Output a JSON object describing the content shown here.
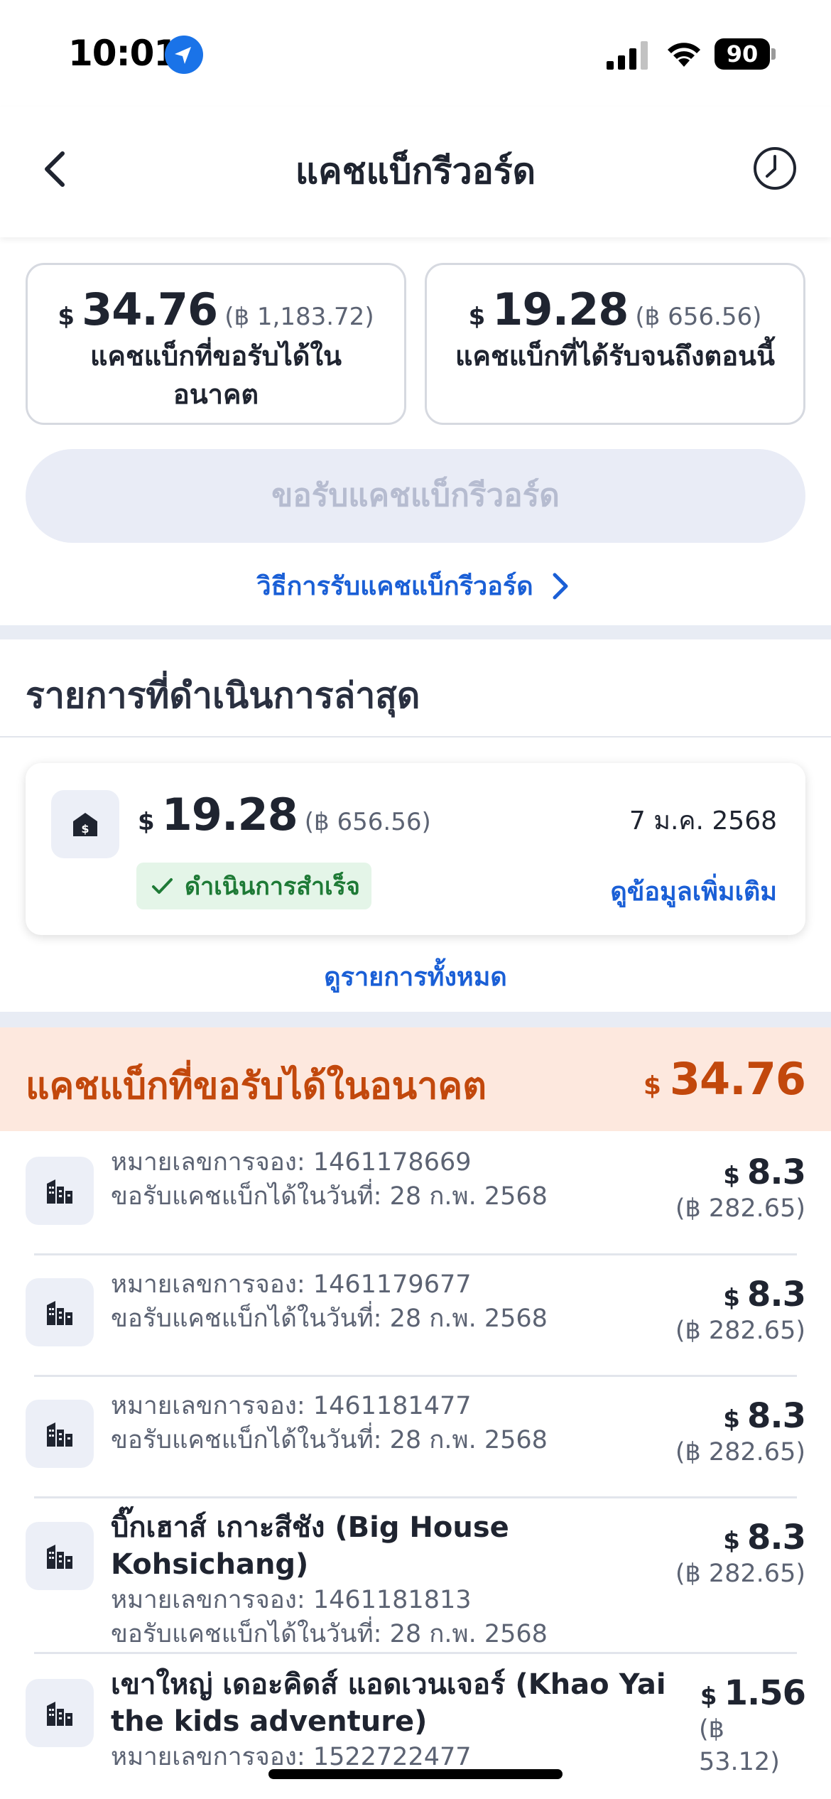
{
  "status": {
    "time": "10:01",
    "battery": "90"
  },
  "header": {
    "title": "แคชแบ็กรีวอร์ด"
  },
  "summary": {
    "future": {
      "currency": "$",
      "amount": "34.76",
      "thb": "(฿ 1,183.72)",
      "label": "แคชแบ็กที่ขอรับได้ในอนาคต"
    },
    "received": {
      "currency": "$",
      "amount": "19.28",
      "thb": "(฿ 656.56)",
      "label": "แคชแบ็กที่ได้รับจนถึงตอนนี้"
    },
    "claim_label": "ขอรับแคชแบ็กรีวอร์ด",
    "howto_label": "วิธีการรับแคชแบ็กรีวอร์ด"
  },
  "recent": {
    "title": "รายการที่ดำเนินการล่าสุด",
    "transaction": {
      "currency": "$",
      "amount": "19.28",
      "thb": "(฿ 656.56)",
      "date": "7 ม.ค. 2568",
      "status": "ดำเนินการสำเร็จ",
      "more_label": "ดูข้อมูลเพิ่มเติม"
    },
    "view_all_label": "ดูรายการทั้งหมด"
  },
  "future_section": {
    "title": "แคชแบ็กที่ขอรับได้ในอนาคต",
    "currency": "$",
    "total": "34.76",
    "bookings": [
      {
        "name": "",
        "booking": "หมายเลขการจอง: 1461178669",
        "claim_date": "ขอรับแคชแบ็กได้ในวันที่: 28 ก.พ. 2568",
        "currency": "$",
        "amount": "8.3",
        "thb": "(฿ 282.65)"
      },
      {
        "name": "",
        "booking": "หมายเลขการจอง: 1461179677",
        "claim_date": "ขอรับแคชแบ็กได้ในวันที่: 28 ก.พ. 2568",
        "currency": "$",
        "amount": "8.3",
        "thb": "(฿ 282.65)"
      },
      {
        "name": "",
        "booking": "หมายเลขการจอง: 1461181477",
        "claim_date": "ขอรับแคชแบ็กได้ในวันที่: 28 ก.พ. 2568",
        "currency": "$",
        "amount": "8.3",
        "thb": "(฿ 282.65)"
      },
      {
        "name": "บิ๊กเฮาส์ เกาะสีชัง (Big House Kohsichang)",
        "booking": "หมายเลขการจอง: 1461181813",
        "claim_date": "ขอรับแคชแบ็กได้ในวันที่: 28 ก.พ. 2568",
        "currency": "$",
        "amount": "8.3",
        "thb": "(฿ 282.65)"
      },
      {
        "name": "เขาใหญ่ เดอะคิดส์ แอดเวนเจอร์ (Khao Yai the kids adventure)",
        "booking": "หมายเลขการจอง: 1522722477",
        "claim_date": "",
        "currency": "$",
        "amount": "1.56",
        "thb": "(฿ 53.12)"
      }
    ]
  }
}
